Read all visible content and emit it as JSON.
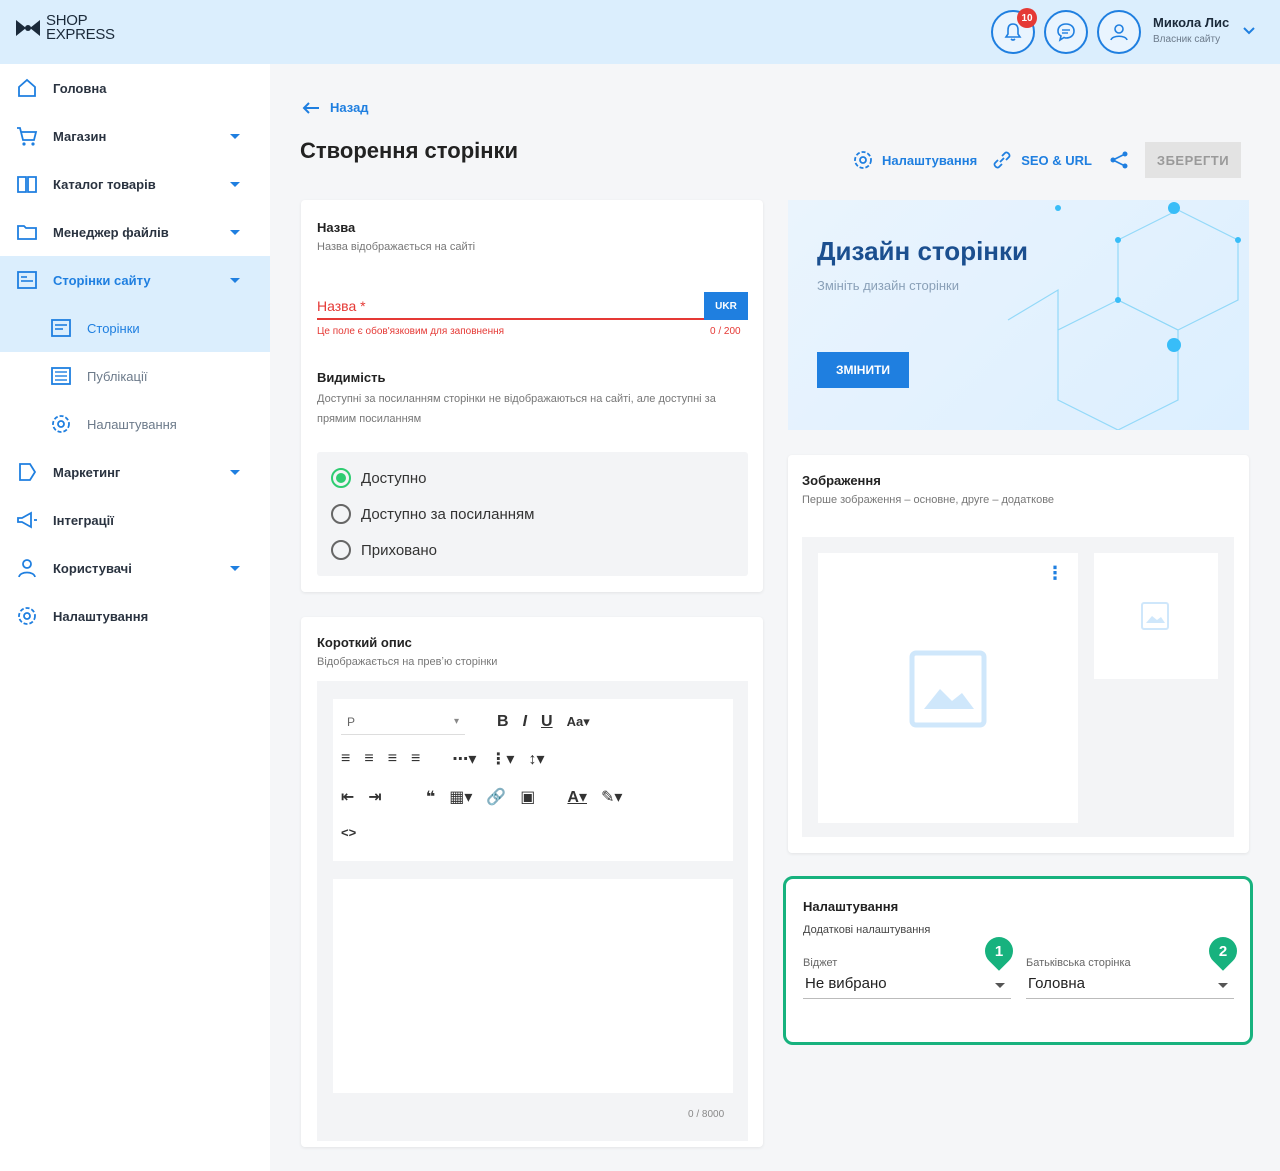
{
  "header": {
    "logo_line1": "SHOP",
    "logo_line2": "EXPRESS",
    "notifications_count": "10",
    "user_name": "Микола Лис",
    "user_role": "Власник сайту"
  },
  "sidebar": {
    "items": [
      {
        "label": "Головна"
      },
      {
        "label": "Магазин"
      },
      {
        "label": "Каталог товарів"
      },
      {
        "label": "Менеджер файлів"
      },
      {
        "label": "Сторінки сайту"
      },
      {
        "label": "Сторінки"
      },
      {
        "label": "Публікації"
      },
      {
        "label": "Налаштування"
      },
      {
        "label": "Маркетинг"
      },
      {
        "label": "Інтеграції"
      },
      {
        "label": "Користувачі"
      },
      {
        "label": "Налаштування"
      }
    ]
  },
  "page": {
    "back_label": "Назад",
    "title": "Створення сторінки",
    "settings_link": "Налаштування",
    "seo_link": "SEO & URL",
    "save_label": "ЗБЕРЕГТИ"
  },
  "name_card": {
    "title": "Назва",
    "subtitle": "Назва відображається на сайті",
    "placeholder": "Назва *",
    "lang": "UKR",
    "error": "Це поле є обов'язковим для заповнення",
    "counter": "0 / 200",
    "visibility_title": "Видимість",
    "visibility_sub": "Доступні за посиланням сторінки не відображаються на сайті, але доступні за прямим посиланням",
    "options": [
      "Доступно",
      "Доступно за посиланням",
      "Приховано"
    ],
    "selected_option": "Доступно"
  },
  "short_desc": {
    "title": "Короткий опис",
    "subtitle": "Відображається на превʼю сторінки",
    "format_value": "P",
    "counter": "0 / 8000"
  },
  "design": {
    "title": "Дизайн сторінки",
    "subtitle": "Змініть дизайн сторінки",
    "button": "ЗМІНИТИ"
  },
  "images": {
    "title": "Зображення",
    "subtitle": "Перше зображення – основне, друге – додаткове"
  },
  "settings": {
    "title": "Налаштування",
    "subtitle": "Додаткові налаштування",
    "widget_label": "Віджет",
    "widget_value": "Не вибрано",
    "parent_label": "Батьківська сторінка",
    "parent_value": "Головна",
    "pin1": "1",
    "pin2": "2"
  },
  "colors": {
    "accent": "#1f7fe0",
    "header_bg": "#dbeefd",
    "error": "#e53935",
    "highlight": "#17b27e"
  }
}
